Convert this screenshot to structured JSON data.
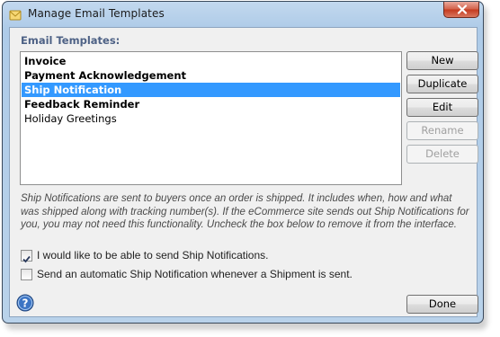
{
  "window": {
    "title": "Manage Email Templates",
    "close_icon": "close-icon",
    "accent_color": "#3399ff"
  },
  "templates": {
    "label": "Email Templates:",
    "items": [
      {
        "label": "Invoice",
        "bold": true,
        "selected": false
      },
      {
        "label": "Payment Acknowledgement",
        "bold": true,
        "selected": false
      },
      {
        "label": "Ship Notification",
        "bold": true,
        "selected": true
      },
      {
        "label": "Feedback Reminder",
        "bold": true,
        "selected": false
      },
      {
        "label": "Holiday Greetings",
        "bold": false,
        "selected": false
      }
    ]
  },
  "buttons": {
    "new": "New",
    "duplicate": "Duplicate",
    "edit": "Edit",
    "rename": "Rename",
    "delete": "Delete",
    "done": "Done"
  },
  "description": "Ship Notifications are sent to buyers once an order is shipped. It includes when, how and what was shipped along with tracking number(s). If the eCommerce site sends out Ship Notifications for you, you may not need this functionality. Uncheck the box below to remove it from the interface.",
  "options": {
    "enable_ship_notifications": {
      "label": "I would like to be able to send Ship Notifications.",
      "checked": true
    },
    "auto_send": {
      "label": "Send an automatic Ship Notification whenever a Shipment is sent.",
      "checked": false
    }
  },
  "help": {
    "icon": "help-icon"
  }
}
